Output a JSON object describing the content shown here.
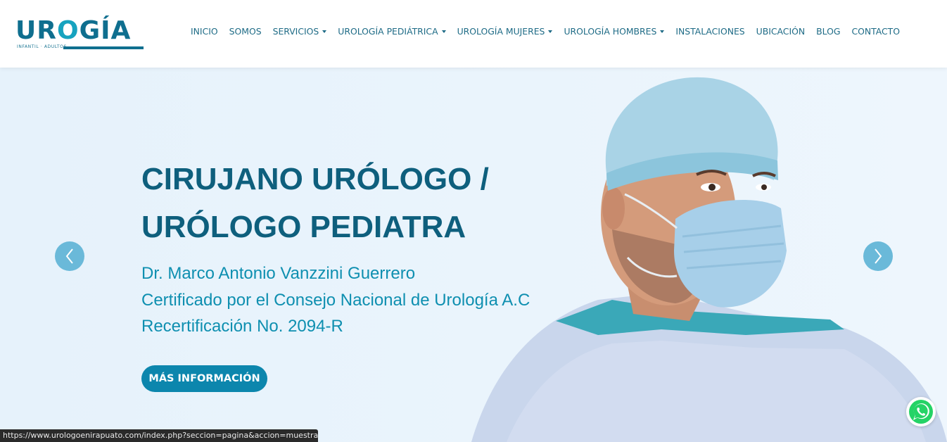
{
  "logo": {
    "word_start": "UR",
    "word_mark": "O",
    "word_end": "GÍA",
    "tagline": "INFANTIL · ADULTOS"
  },
  "nav": [
    {
      "label": "INICIO",
      "dropdown": false
    },
    {
      "label": "SOMOS",
      "dropdown": false
    },
    {
      "label": "SERVICIOS",
      "dropdown": true
    },
    {
      "label": "UROLOGÍA PEDIÁTRICA",
      "dropdown": true
    },
    {
      "label": "UROLOGÍA MUJERES",
      "dropdown": true
    },
    {
      "label": "UROLOGÍA HOMBRES",
      "dropdown": true
    },
    {
      "label": "INSTALACIONES",
      "dropdown": false
    },
    {
      "label": "UBICACIÓN",
      "dropdown": false
    },
    {
      "label": "BLOG",
      "dropdown": false
    },
    {
      "label": "CONTACTO",
      "dropdown": false
    }
  ],
  "hero": {
    "headline_line1": "CIRUJANO URÓLOGO /",
    "headline_line2": "URÓLOGO PEDIATRA",
    "doctor_name": "Dr. Marco Antonio Vanzzini Guerrero",
    "certification": "Certificado por el Consejo Nacional de Urología A.C",
    "recertification": "Recertificación No. 2094-R",
    "cta_label": "MÁS INFORMACIÓN"
  },
  "status_bar": {
    "url": "https://www.urologoenirapuato.com/index.php?seccion=pagina&accion=muestra..."
  },
  "icons": {
    "prev": "chevron-left-icon",
    "next": "chevron-right-icon",
    "whatsapp": "whatsapp-icon"
  },
  "colors": {
    "brand_dark": "#0e5f7d",
    "brand_accent": "#0e8fb0",
    "cta_bg": "#0c86ad",
    "arrow_bg": "#6ab9d9",
    "hero_bg": "#e8f3fc",
    "whatsapp_green": "#25d366"
  }
}
